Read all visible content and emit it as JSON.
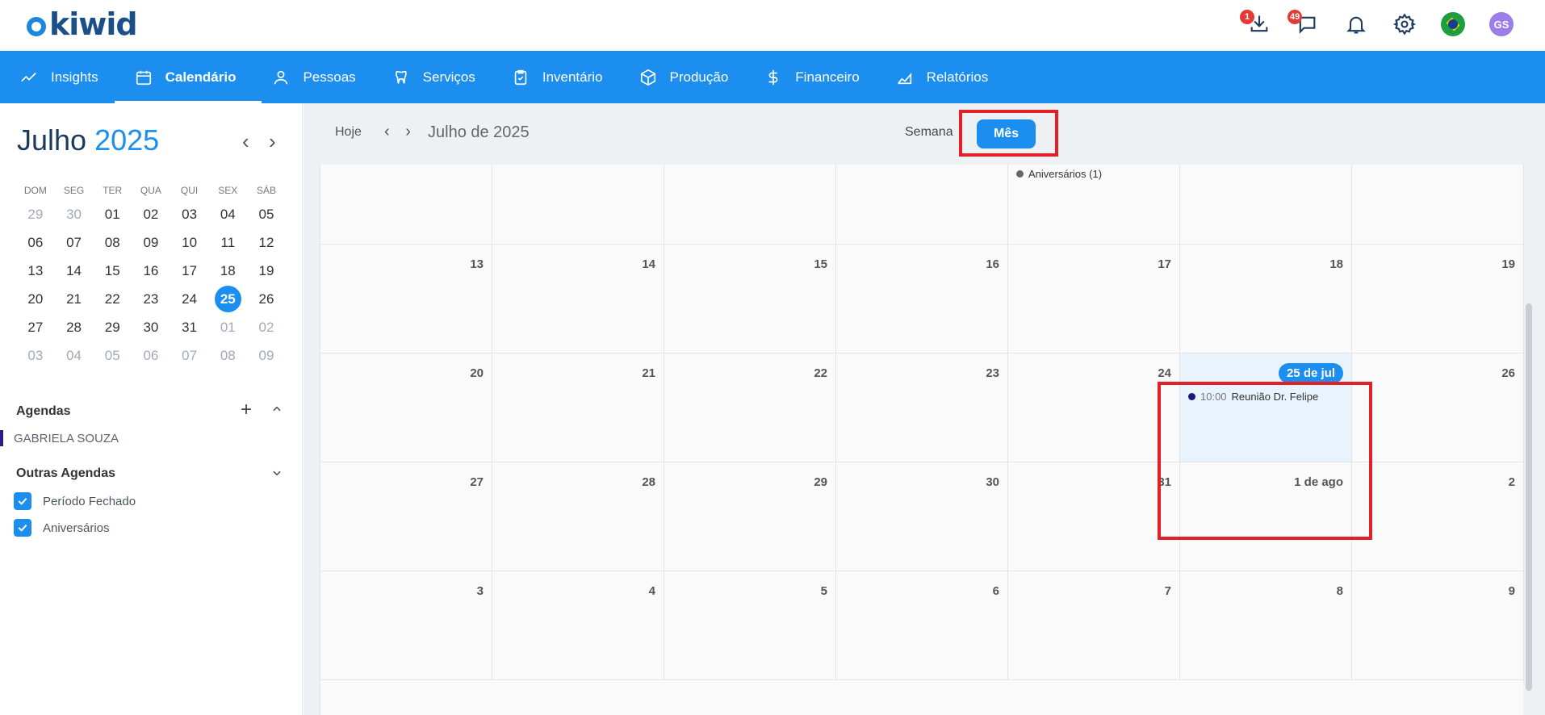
{
  "app": {
    "logo_text": "kiwid"
  },
  "header": {
    "download_badge": "1",
    "messages_badge": "49",
    "avatar_initials": "GS"
  },
  "nav": {
    "items": [
      {
        "label": "Insights",
        "icon": "trend-line-icon"
      },
      {
        "label": "Calendário",
        "icon": "calendar-icon",
        "active": true
      },
      {
        "label": "Pessoas",
        "icon": "person-icon"
      },
      {
        "label": "Serviços",
        "icon": "tooth-icon"
      },
      {
        "label": "Inventário",
        "icon": "clipboard-check-icon"
      },
      {
        "label": "Produção",
        "icon": "box-icon"
      },
      {
        "label": "Financeiro",
        "icon": "dollar-icon"
      },
      {
        "label": "Relatórios",
        "icon": "area-chart-icon"
      }
    ]
  },
  "mini_calendar": {
    "month": "Julho",
    "year": "2025",
    "weekdays": [
      "DOM",
      "SEG",
      "TER",
      "QUA",
      "QUI",
      "SEX",
      "SÁB"
    ],
    "weeks": [
      [
        [
          "29",
          1
        ],
        [
          "30",
          1
        ],
        [
          "01",
          0
        ],
        [
          "02",
          0
        ],
        [
          "03",
          0
        ],
        [
          "04",
          0
        ],
        [
          "05",
          0
        ]
      ],
      [
        [
          "06",
          0
        ],
        [
          "07",
          0
        ],
        [
          "08",
          0
        ],
        [
          "09",
          0
        ],
        [
          "10",
          0
        ],
        [
          "11",
          0
        ],
        [
          "12",
          0
        ]
      ],
      [
        [
          "13",
          0
        ],
        [
          "14",
          0
        ],
        [
          "15",
          0
        ],
        [
          "16",
          0
        ],
        [
          "17",
          0
        ],
        [
          "18",
          0
        ],
        [
          "19",
          0
        ]
      ],
      [
        [
          "20",
          0
        ],
        [
          "21",
          0
        ],
        [
          "22",
          0
        ],
        [
          "23",
          0
        ],
        [
          "24",
          0
        ],
        [
          "25",
          2
        ],
        [
          "26",
          0
        ]
      ],
      [
        [
          "27",
          0
        ],
        [
          "28",
          0
        ],
        [
          "29",
          0
        ],
        [
          "30",
          0
        ],
        [
          "31",
          0
        ],
        [
          "01",
          1
        ],
        [
          "02",
          1
        ]
      ],
      [
        [
          "03",
          1
        ],
        [
          "04",
          1
        ],
        [
          "05",
          1
        ],
        [
          "06",
          1
        ],
        [
          "07",
          1
        ],
        [
          "08",
          1
        ],
        [
          "09",
          1
        ]
      ]
    ]
  },
  "agendas": {
    "title": "Agendas",
    "user": "GABRIELA SOUZA",
    "others_title": "Outras Agendas",
    "others": [
      {
        "label": "Período Fechado",
        "checked": true
      },
      {
        "label": "Aniversários",
        "checked": true
      }
    ]
  },
  "toolbar": {
    "today_label": "Hoje",
    "current_month": "Julho de 2025",
    "week_label": "Semana",
    "month_label": "Mês"
  },
  "calendar": {
    "top_week_event": "Aniversários (1)",
    "weeks": [
      [
        "",
        "",
        "",
        "",
        "",
        "",
        ""
      ],
      [
        "13",
        "14",
        "15",
        "16",
        "17",
        "18",
        "19"
      ],
      [
        "20",
        "21",
        "22",
        "23",
        "24",
        "25 de jul",
        "26"
      ],
      [
        "27",
        "28",
        "29",
        "30",
        "31",
        "1 de ago",
        "2"
      ],
      [
        "3",
        "4",
        "5",
        "6",
        "7",
        "8",
        "9"
      ]
    ],
    "selected_event": {
      "time": "10:00",
      "title": "Reunião Dr. Felipe"
    }
  },
  "colors": {
    "primary": "#1b8ef0",
    "highlight": "#e32027",
    "event_dot": "#1a1a7a"
  }
}
